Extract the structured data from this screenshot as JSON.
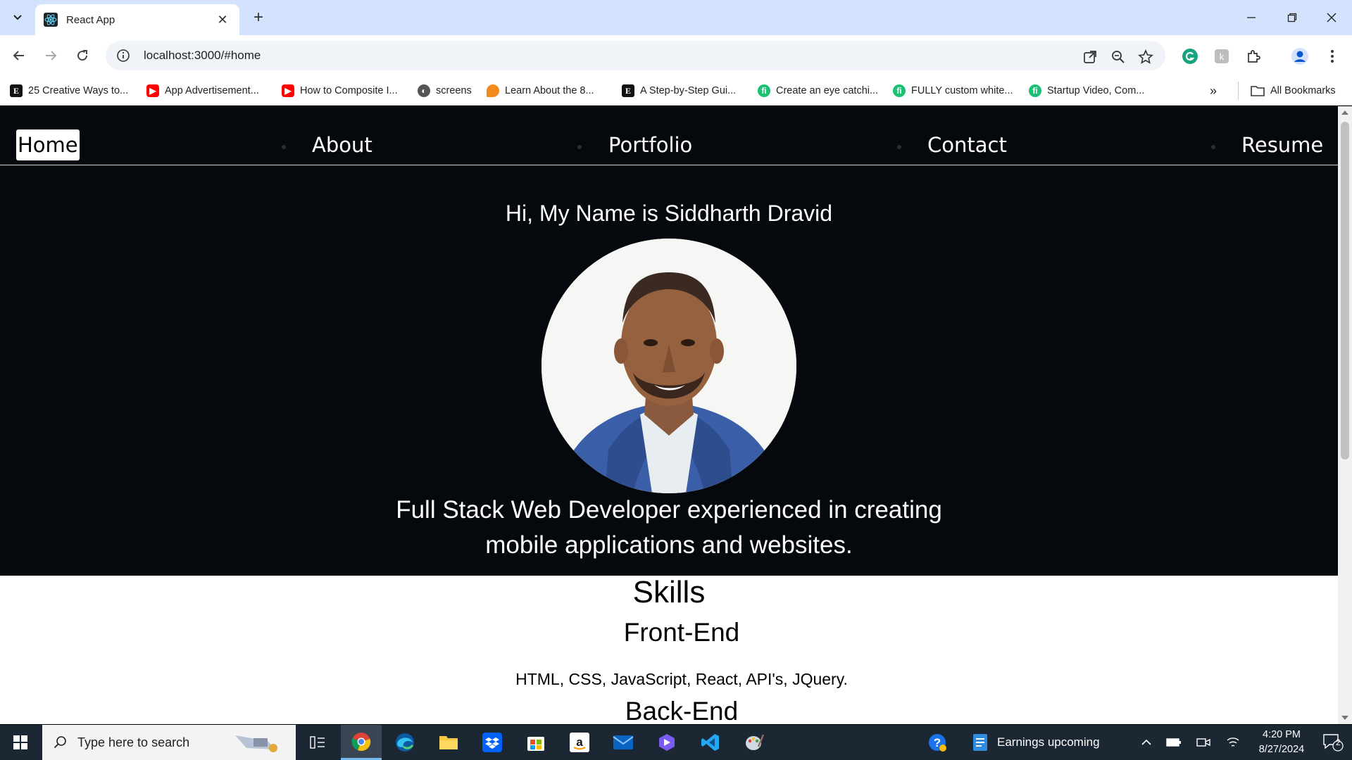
{
  "browser": {
    "tab_title": "React App",
    "url": "localhost:3000/#home",
    "bookmarks": [
      {
        "label": "25 Creative Ways to...",
        "icon": "E"
      },
      {
        "label": "App Advertisement...",
        "icon": "youtube"
      },
      {
        "label": "How to Composite I...",
        "icon": "youtube"
      },
      {
        "label": "screens",
        "icon": "globe"
      },
      {
        "label": "Learn About the 8...",
        "icon": "orange"
      },
      {
        "label": "A Step-by-Step Gui...",
        "icon": "E"
      },
      {
        "label": "Create an eye catchi...",
        "icon": "fiverr"
      },
      {
        "label": "FULLY custom white...",
        "icon": "fiverr"
      },
      {
        "label": "Startup Video, Com...",
        "icon": "fiverr"
      }
    ],
    "all_bookmarks": "All Bookmarks"
  },
  "page": {
    "nav": {
      "items": [
        "Home",
        "About",
        "Portfolio",
        "Contact",
        "Resume"
      ],
      "active": "Home"
    },
    "greeting": "Hi, My Name is Siddharth Dravid",
    "tagline_line1": "Full Stack Web Developer experienced in creating",
    "tagline_line2": "mobile applications and websites.",
    "skills": {
      "title": "Skills",
      "frontend_title": "Front-End",
      "frontend_list": "HTML, CSS, JavaScript, React, API's, JQuery.",
      "backend_title": "Back-End"
    }
  },
  "taskbar": {
    "search_placeholder": "Type here to search",
    "news": "Earnings upcoming",
    "time": "4:20 PM",
    "date": "8/27/2024",
    "notifications": "2"
  },
  "colors": {
    "hero_bg": "#05080c",
    "titlebar": "#d3e3fd",
    "taskbar": "#1c2734"
  }
}
